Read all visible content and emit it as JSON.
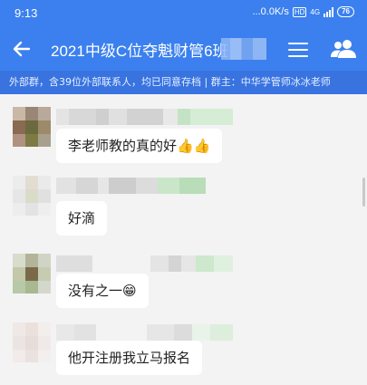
{
  "status_bar": {
    "time": "9:13",
    "network_speed": "...0.0K/s",
    "hd_label": "HD",
    "network_type": "4G",
    "battery": "76"
  },
  "header": {
    "title": "2021中级C位夺魁财管6班",
    "back_icon": "arrow-left-icon",
    "menu_icon": "hamburger-menu-icon",
    "members_icon": "group-members-icon"
  },
  "group_info": {
    "text": "外部群，含39位外部联系人，均已同意存档 | 群主：中华学管师冰冰老师"
  },
  "messages": [
    {
      "text": "李老师教的真的好",
      "emoji": "👍👍"
    },
    {
      "text": "好滴",
      "emoji": ""
    },
    {
      "text": "没有之一",
      "emoji": "😁"
    },
    {
      "text": "他开注册我立马报名",
      "emoji": ""
    }
  ],
  "colors": {
    "header_bg": "#3b80ee",
    "info_bar_bg": "#3873e0",
    "chat_bg": "#f3f3f3",
    "bubble_bg": "#ffffff"
  }
}
